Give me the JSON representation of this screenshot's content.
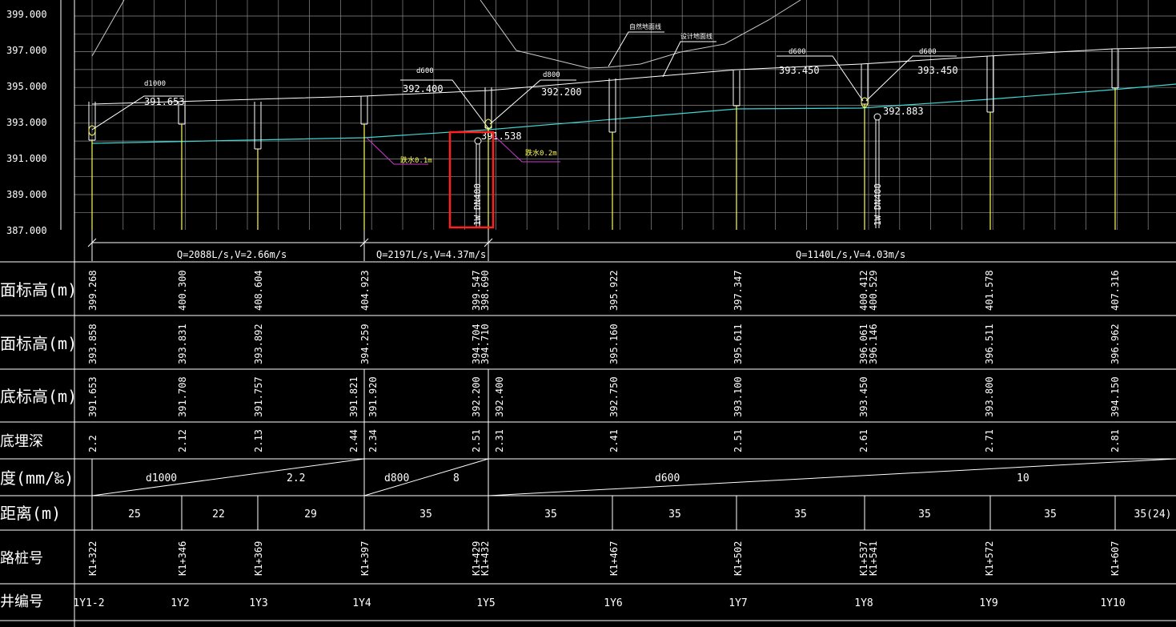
{
  "y_axis": {
    "labels": [
      "399.000",
      "397.000",
      "395.000",
      "393.000",
      "391.000",
      "389.000",
      "387.000"
    ]
  },
  "profile_notes": {
    "natural_ground": "自然地面线",
    "design_ground": "设计地面线"
  },
  "callouts": [
    {
      "size": "d1000",
      "elev": "391.653"
    },
    {
      "size": "d600",
      "elev": "392.400"
    },
    {
      "size": "d800",
      "elev": "392.200"
    },
    {
      "size": "d600",
      "elev": "393.450"
    },
    {
      "size": "d600",
      "elev": "393.450"
    }
  ],
  "crossing_labels": {
    "elev_left": "391.538",
    "elev_right": "392.883",
    "pipe_left": "1W DN400",
    "pipe_right": "1W DN400",
    "note_left": "跌水0.1m",
    "note_right": "跌水0.2m"
  },
  "flow_segments": [
    "Q=2088L/s,V=2.66m/s",
    "Q=2197L/s,V=4.37m/s",
    "Q=1140L/s,V=4.03m/s"
  ],
  "row_headers": [
    "面标高(m)",
    "面标高(m)",
    "底标高(m)",
    "底埋深",
    "度(mm/‰)",
    "距离(m)",
    "路桩号",
    "井编号"
  ],
  "rows": {
    "existing_ground": [
      "399.268",
      "400.300",
      "408.604",
      "404.923",
      "399.547",
      "398.690",
      "395.922",
      "397.347",
      "400.412",
      "400.529",
      "401.578",
      "407.316"
    ],
    "design_ground": [
      "393.858",
      "393.831",
      "393.892",
      "394.259",
      "394.704",
      "394.710",
      "395.160",
      "395.611",
      "396.061",
      "396.146",
      "396.511",
      "396.962"
    ],
    "invert": [
      "391.653",
      "391.708",
      "391.757",
      "391.821",
      "391.920",
      "392.200",
      "392.400",
      "392.750",
      "393.100",
      "393.450",
      "393.800",
      "394.150"
    ],
    "depth": [
      "2.2",
      "2.12",
      "2.13",
      "2.44",
      "2.34",
      "2.51",
      "2.31",
      "2.41",
      "2.51",
      "2.61",
      "2.71",
      "2.81"
    ],
    "slope": [
      {
        "size": "d1000",
        "grade": "2.2"
      },
      {
        "size": "d800",
        "grade": "8"
      },
      {
        "size": "d600",
        "grade": "10"
      }
    ],
    "distance": [
      "25",
      "22",
      "29",
      "35",
      "35",
      "35",
      "35",
      "35",
      "35",
      "35(24)"
    ],
    "chainage": [
      "K1+322",
      "K1+346",
      "K1+369",
      "K1+397",
      "K1+429",
      "K1+432",
      "K1+467",
      "K1+502",
      "K1+537",
      "K1+541",
      "K1+572",
      "K1+607"
    ],
    "manhole": [
      "1Y1-2",
      "1Y2",
      "1Y3",
      "1Y4",
      "1Y5",
      "1Y6",
      "1Y7",
      "1Y8",
      "1Y9",
      "1Y10"
    ]
  }
}
